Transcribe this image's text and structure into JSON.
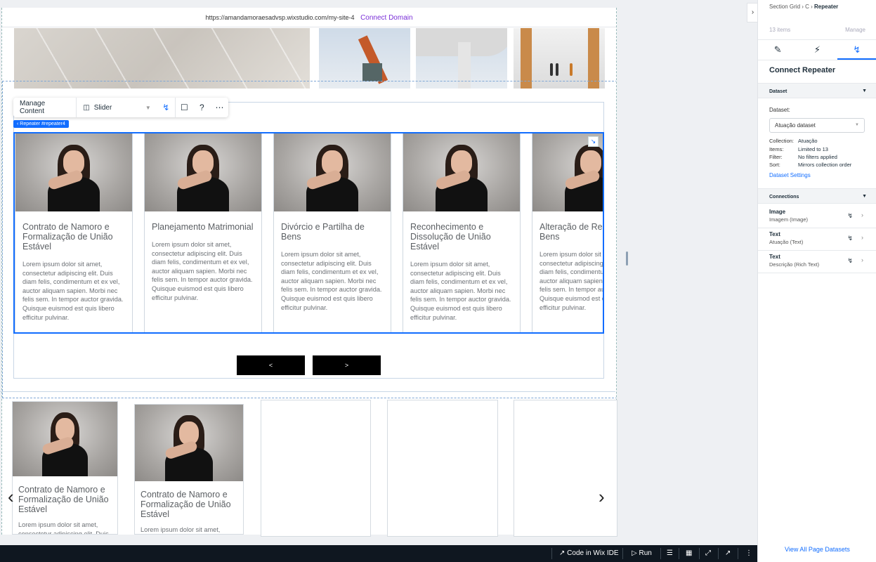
{
  "site": {
    "url": "https://amandamoraesadvsp.wixstudio.com/my-site-4",
    "connect_domain": "Connect Domain"
  },
  "toolbar": {
    "manage_content": "Manage Content",
    "slider_label": "Slider",
    "help": "?",
    "more": "⋯"
  },
  "repeater_tag": "Repeater #repeater4",
  "cards": [
    {
      "title": "Contrato de Namoro e Formalização de União Estável",
      "body": "Lorem ipsum dolor sit amet, consectetur adipiscing elit. Duis diam felis, condimentum et ex vel, auctor aliquam sapien. Morbi nec felis sem. In tempor auctor gravida. Quisque euismod est quis libero efficitur pulvinar."
    },
    {
      "title": "Planejamento Matrimonial",
      "body": "Lorem ipsum dolor sit amet, consectetur adipiscing elit. Duis diam felis, condimentum et ex vel, auctor aliquam sapien. Morbi nec felis sem. In tempor auctor gravida. Quisque euismod est quis libero efficitur pulvinar."
    },
    {
      "title": "Divórcio e Partilha de Bens",
      "body": "Lorem ipsum dolor sit amet, consectetur adipiscing elit. Duis diam felis, condimentum et ex vel, auctor aliquam sapien. Morbi nec felis sem. In tempor auctor gravida. Quisque euismod est quis libero efficitur pulvinar."
    },
    {
      "title": "Reconhecimento e Dissolução de União Estável",
      "body": "Lorem ipsum dolor sit amet, consectetur adipiscing elit. Duis diam felis, condimentum et ex vel, auctor aliquam sapien. Morbi nec felis sem. In tempor auctor gravida. Quisque euismod est quis libero efficitur pulvinar."
    },
    {
      "title": "Alteração de Regime de Bens",
      "body": "Lorem ipsum dolor sit amet, consectetur adipiscing elit. Duis diam felis, condimentum et ex vel, auctor aliquam sapien. Morbi nec felis sem. In tempor auctor gravida. Quisque euismod est quis libero efficitur pulvinar."
    }
  ],
  "slider_nav": {
    "prev": "<",
    "next": ">"
  },
  "lower_cards": [
    {
      "title": "Contrato de Namoro e Formalização de União Estável",
      "body": "Lorem ipsum dolor sit amet, consectetur adipiscing elit. Duis"
    },
    {
      "title": "Contrato de Namoro e Formalização de União Estável",
      "body": "Lorem ipsum dolor sit amet,"
    }
  ],
  "lower_nav": {
    "prev": "‹",
    "next": "›"
  },
  "bottombar": {
    "code_ide": "Code in Wix IDE",
    "run": "Run"
  },
  "panel": {
    "breadcrumb": {
      "a": "Section Grid",
      "b": "C",
      "c": "Repeater"
    },
    "items_count": "13 items",
    "manage": "Manage",
    "title": "Connect Repeater",
    "dataset_section": "Dataset",
    "dataset_label": "Dataset:",
    "dataset_value": "Atuação dataset",
    "collection_k": "Collection:",
    "collection_v": "Atuação",
    "items_k": "Items:",
    "items_v": "Limited to 13",
    "filter_k": "Filter:",
    "filter_v": "No filters applied",
    "sort_k": "Sort:",
    "sort_v": "Mirrors collection order",
    "dataset_settings": "Dataset Settings",
    "connections_section": "Connections",
    "connections": [
      {
        "type": "Image",
        "field": "Imagem (Image)"
      },
      {
        "type": "Text",
        "field": "Atuação (Text)"
      },
      {
        "type": "Text",
        "field": "Descrição (Rich Text)"
      }
    ],
    "view_all": "View All Page Datasets"
  },
  "colors": {
    "accent": "#116dff",
    "connect_domain": "#7a2fd8",
    "bottombar": "#0f1720"
  }
}
